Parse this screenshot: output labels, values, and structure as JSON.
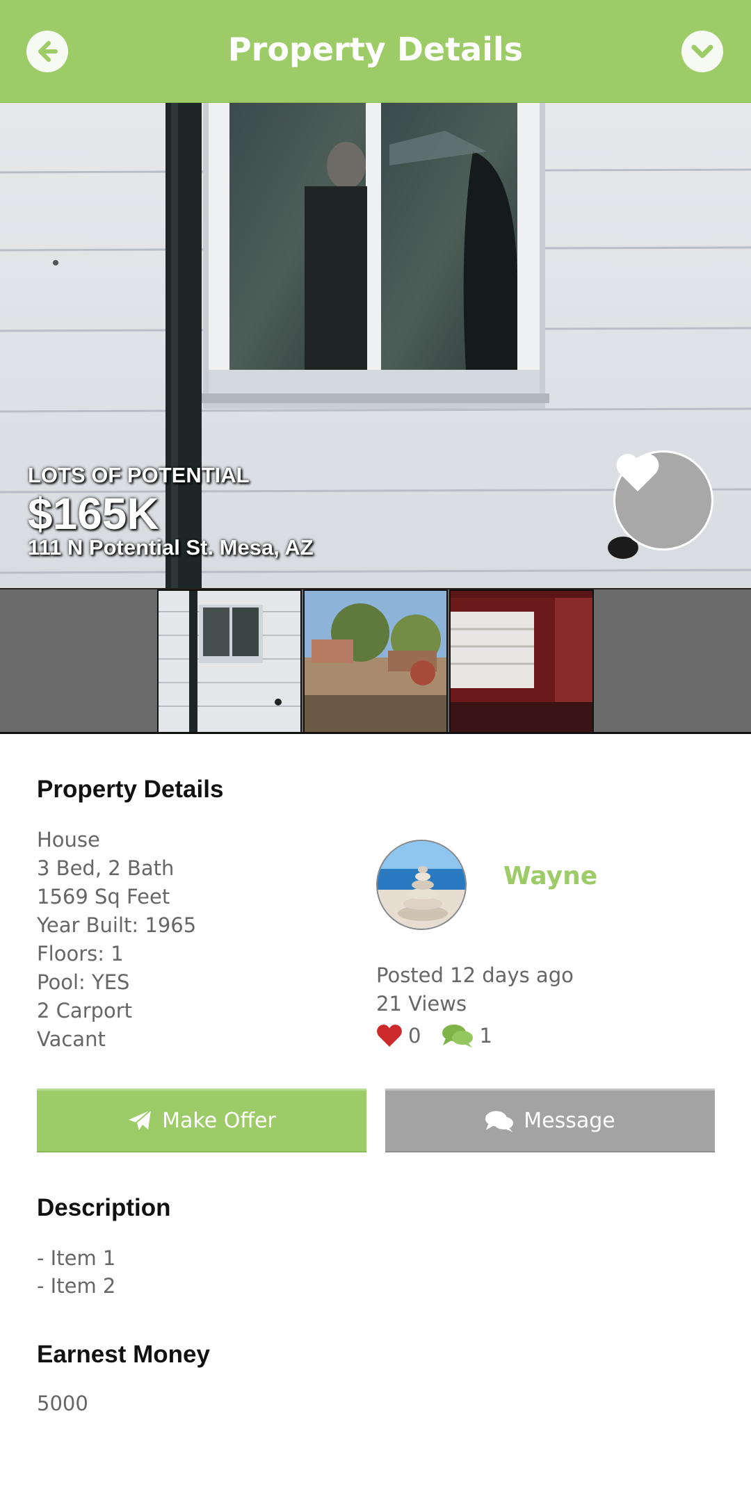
{
  "header": {
    "title": "Property Details",
    "back_icon": "arrow-left-circle-icon",
    "dropdown_icon": "chevron-down-circle-icon",
    "bg_color": "#9ccb67"
  },
  "hero": {
    "tagline": "LOTS OF POTENTIAL",
    "price": "$165K",
    "address": "111 N Potential St. Mesa, AZ",
    "favorite_icon": "heart-icon"
  },
  "thumbnails": [
    {
      "name": "thumbnail-1",
      "subject": "house exterior window"
    },
    {
      "name": "thumbnail-2",
      "subject": "front yard"
    },
    {
      "name": "thumbnail-3",
      "subject": "interior room"
    }
  ],
  "details": {
    "heading": "Property Details",
    "items": [
      "House",
      "3 Bed, 2 Bath",
      "1569 Sq Feet",
      "Year Built: 1965",
      "Floors: 1",
      "Pool: YES",
      "2 Carport",
      "Vacant"
    ]
  },
  "owner": {
    "name": "Wayne",
    "posted": "Posted 12 days ago",
    "views": "21 Views",
    "likes": "0",
    "comments": "1",
    "accent_color": "#9ccb67"
  },
  "actions": {
    "offer_label": "Make Offer",
    "message_label": "Message"
  },
  "description": {
    "heading": "Description",
    "items": [
      "- Item 1",
      "- Item 2"
    ]
  },
  "earnest": {
    "heading": "Earnest Money",
    "value": "5000"
  }
}
